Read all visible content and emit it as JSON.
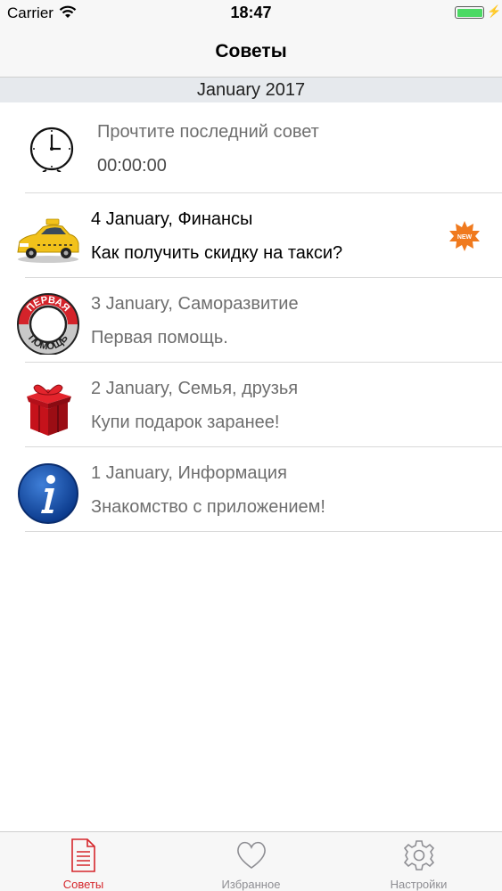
{
  "status_bar": {
    "carrier": "Carrier",
    "time": "18:47",
    "battery_color": "#4cd964"
  },
  "nav": {
    "title": "Советы"
  },
  "section": {
    "title": "January 2017"
  },
  "timer": {
    "label": "Прочтите последний совет",
    "value": "00:00:00",
    "icon": "clock-icon"
  },
  "tips": [
    {
      "date_category": "4 January, Финансы",
      "title": "Как получить скидку на такси?",
      "icon": "taxi-icon",
      "read": false,
      "new_badge": "NEW"
    },
    {
      "date_category": "3 January, Саморазвитие",
      "title": "Первая помощь.",
      "icon": "first-aid-icon",
      "icon_text_top": "ПЕРВАЯ",
      "icon_text_bottom": "ПОМОЩЬ",
      "read": true
    },
    {
      "date_category": "2 January, Семья, друзья",
      "title": "Купи подарок заранее!",
      "icon": "gift-icon",
      "read": true
    },
    {
      "date_category": "1 January, Информация",
      "title": "Знакомство с приложением!",
      "icon": "info-icon",
      "read": true
    }
  ],
  "tab_bar": {
    "tabs": [
      {
        "label": "Советы",
        "icon": "document-icon",
        "active": true
      },
      {
        "label": "Избранное",
        "icon": "heart-icon",
        "active": false
      },
      {
        "label": "Настройки",
        "icon": "gear-icon",
        "active": false
      }
    ],
    "active_color": "#d5262b",
    "inactive_color": "#8e8e93"
  }
}
